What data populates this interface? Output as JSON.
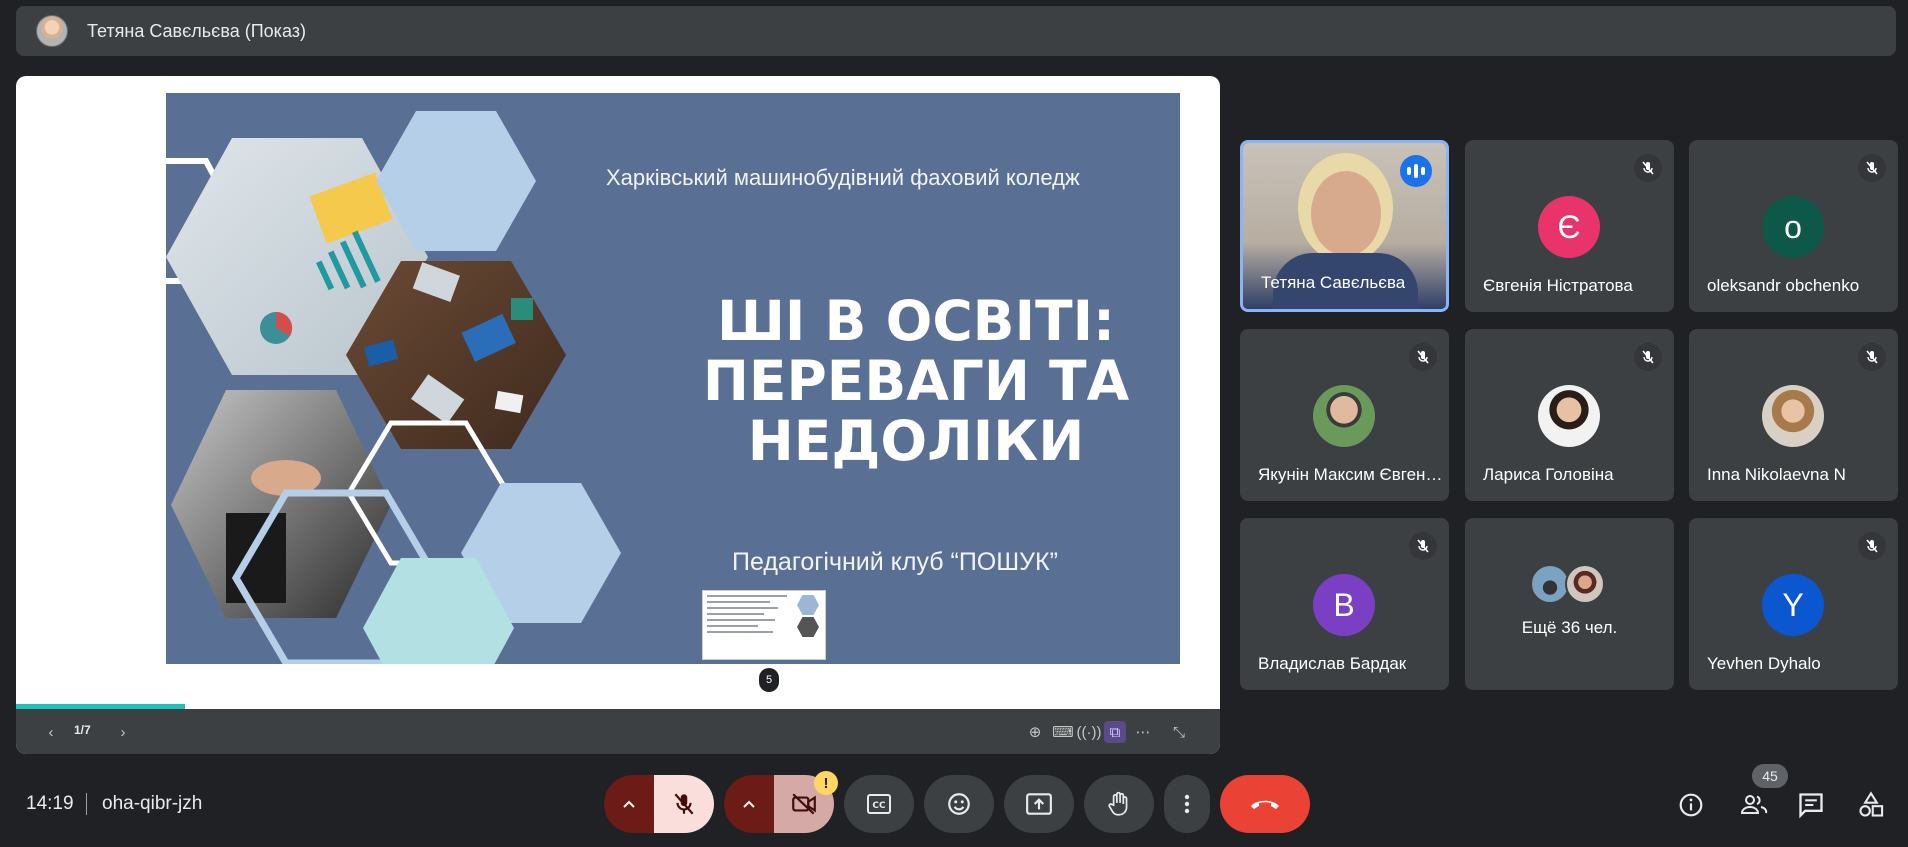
{
  "presenter_bar": {
    "label": "Тетяна Савєльєва (Показ)"
  },
  "slide": {
    "college": "Харківський машинобудівний фаховий коледж",
    "title_lines": [
      "ШІ В ОСВІТІ:",
      "ПЕРЕВАГИ ТА",
      "НЕДОЛІКИ"
    ],
    "club": "Педагогічний клуб “ПОШУК”",
    "page_badge": "5"
  },
  "presentation_controls": {
    "page": "1/7",
    "progress_percent": 14
  },
  "participants": [
    {
      "name": "Тетяна Савєльєва",
      "speaking": true,
      "muted": false
    },
    {
      "name": "Євгенія Ністратова",
      "letter": "Є",
      "color": "#e8336b",
      "muted": true
    },
    {
      "name": "oleksandr obchenko",
      "letter": "o",
      "color": "#0d5848",
      "muted": true
    },
    {
      "name": "Якунін Максим Євгенович",
      "muted": true
    },
    {
      "name": "Лариса Головіна",
      "muted": true
    },
    {
      "name": "Inna Nikolaevna N",
      "muted": true
    },
    {
      "name": "Владислав Бардак",
      "letter": "В",
      "color": "#7b3fc4",
      "muted": true
    },
    {
      "name": "Ещё 36 чел."
    },
    {
      "name": "Yevhen Dyhalo",
      "letter": "Y",
      "color": "#0b57d0",
      "muted": true
    }
  ],
  "bottom_bar": {
    "time": "14:19",
    "meeting_code": "oha-qibr-jzh",
    "participants_count": "45",
    "camera_warning": "!"
  },
  "colors": {
    "background": "#202124",
    "surface": "#3c4043",
    "end_call": "#ea4335",
    "accent_blue": "#8ab4f8",
    "progress": "#1ec1b7"
  }
}
